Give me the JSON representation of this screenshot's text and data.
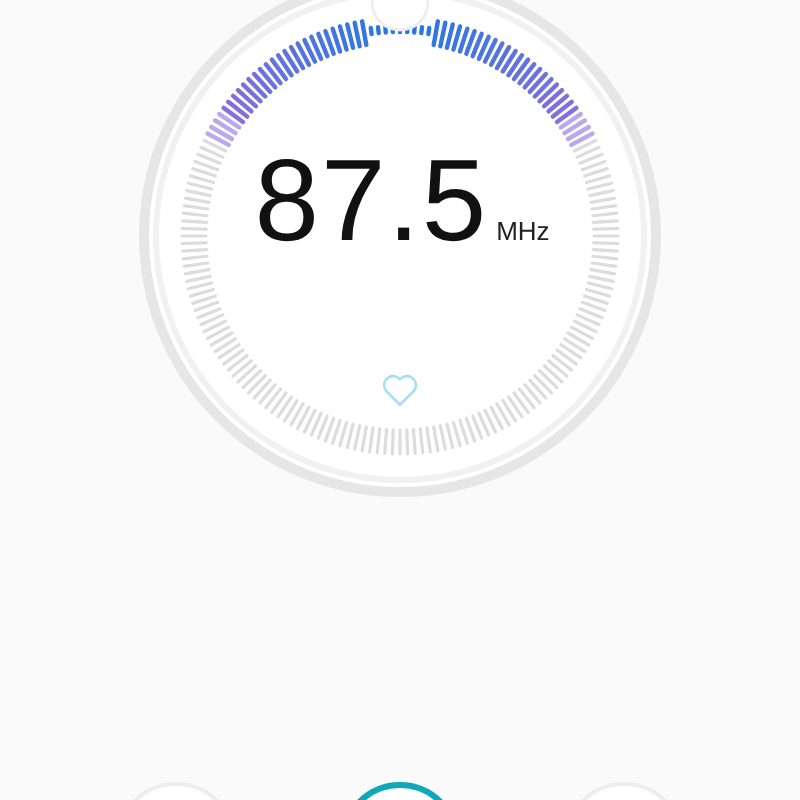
{
  "tuner": {
    "frequency": "87.5",
    "unit": "MHz",
    "favorite": false
  },
  "controls": [
    {
      "kind": "secondary"
    },
    {
      "kind": "primary"
    },
    {
      "kind": "secondary"
    }
  ]
}
